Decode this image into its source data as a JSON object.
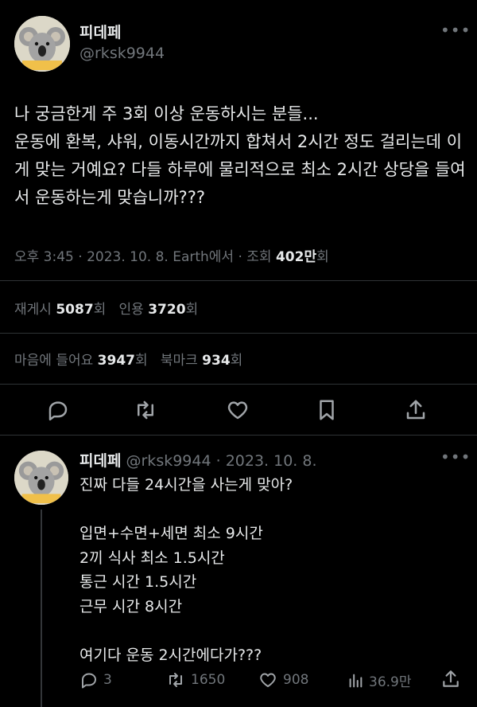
{
  "tweet": {
    "display_name": "피데페",
    "handle": "@rksk9944",
    "more_icon": "more-horizontal-icon",
    "text": "나 궁금한게 주 3회 이상 운동하시는 분들...\n운동에 환복, 샤워, 이동시간까지 합쳐서 2시간 정도 걸리는데 이게 맞는 거예요? 다들 하루에 물리적으로 최소 2시간 상당을 들여서 운동하는게 맞습니까???",
    "meta": "오후 3:45 · 2023. 10. 8. Earth에서 · 조회 ",
    "views_value": "402만",
    "views_suffix": "회",
    "retweets_label": "재게시 ",
    "retweets_value": "5087",
    "retweets_suffix": "회",
    "quotes_label": "인용 ",
    "quotes_value": "3720",
    "quotes_suffix": "회",
    "likes_label": "마음에 들어요 ",
    "likes_value": "3947",
    "likes_suffix": "회",
    "bookmarks_label": "북마크 ",
    "bookmarks_value": "934",
    "bookmarks_suffix": "회"
  },
  "reply": {
    "display_name": "피데페",
    "handle_date": "@rksk9944 · 2023. 10. 8.",
    "text": "진짜 다들 24시간을 사는게 맞아?\n\n입면+수면+세면 최소 9시간\n2끼 식사 최소 1.5시간\n통근 시간 1.5시간\n근무 시간 8시간\n\n여기다 운동 2시간에다가???",
    "replies": "3",
    "retweets": "1650",
    "likes": "908",
    "views": "36.9만"
  },
  "colors": {
    "background": "#000000",
    "text": "#e7e9ea",
    "muted": "#71767b",
    "divider": "#2f3336"
  }
}
